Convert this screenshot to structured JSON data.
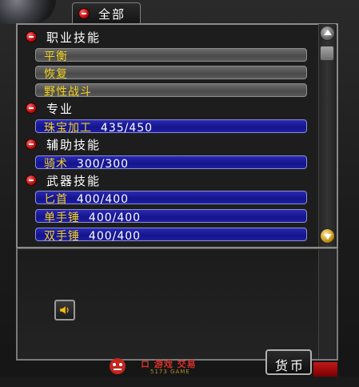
{
  "tab": {
    "label": "全部"
  },
  "categories": [
    {
      "label": "职业技能",
      "skills": [
        {
          "name": "平衡",
          "value": "",
          "style": "gray"
        },
        {
          "name": "恢复",
          "value": "",
          "style": "gray"
        },
        {
          "name": "野性战斗",
          "value": "",
          "style": "gray"
        }
      ]
    },
    {
      "label": "专业",
      "skills": [
        {
          "name": "珠宝加工",
          "value": "435/450",
          "style": "blue"
        }
      ]
    },
    {
      "label": "辅助技能",
      "skills": [
        {
          "name": "骑术",
          "value": "300/300",
          "style": "blue"
        }
      ]
    },
    {
      "label": "武器技能",
      "skills": [
        {
          "name": "匕首",
          "value": "400/400",
          "style": "blue"
        },
        {
          "name": "单手锤",
          "value": "400/400",
          "style": "blue"
        },
        {
          "name": "双手锤",
          "value": "400/400",
          "style": "blue"
        }
      ]
    }
  ],
  "buttons": {
    "currency": "货币"
  },
  "watermark": {
    "title": "ロ 游戏 交易",
    "sub": "5173 GAME"
  },
  "icons": {
    "collapse": "minus-icon",
    "scroll_up": "arrow-up-icon",
    "scroll_down": "arrow-down-icon",
    "sound": "speaker-icon"
  },
  "colors": {
    "skill_name": "#f2d21a",
    "skill_value": "#ffffff",
    "bar_blue": "#1a1a9e",
    "bar_gray": "#5a5a5a",
    "collapse_red": "#c41313"
  }
}
